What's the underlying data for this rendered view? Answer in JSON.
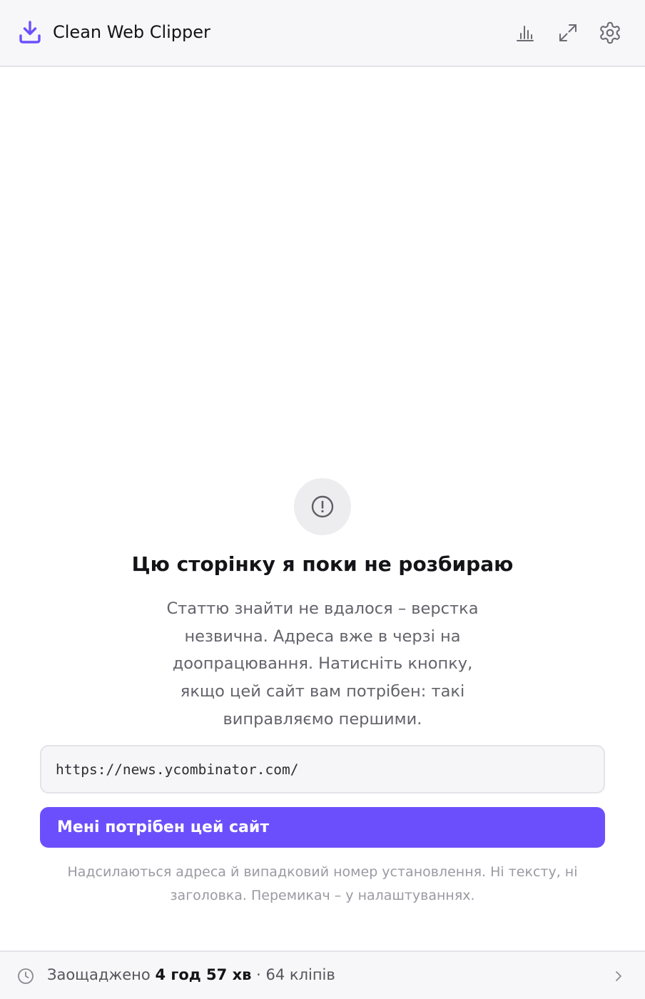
{
  "header": {
    "title": "Clean Web Clipper",
    "brand_icon": "download-tray-icon",
    "actions": [
      {
        "name": "stats-button",
        "icon": "bar-chart-icon"
      },
      {
        "name": "expand-button",
        "icon": "expand-arrows-icon"
      },
      {
        "name": "settings-button",
        "icon": "gear-icon"
      }
    ]
  },
  "empty_state": {
    "icon": "alert-circle-icon",
    "title": "Цю сторінку я поки не розбираю",
    "description_lines": [
      "Статтю знайти не вдалося – верстка",
      "незвична. Адреса вже в черзі на",
      "доопрацювання. Натисніть кнопку,",
      "якщо цей сайт вам потрібен: такі",
      "виправляємо першими."
    ],
    "url": "https://news.ycombinator.com/",
    "button_label": "Мені потрібен цей сайт",
    "note_lines": [
      "Надсилаються адреса й випадковий номер установлення. Ні тексту, ні",
      "заголовка. Перемикач – у налаштуваннях."
    ]
  },
  "footer": {
    "icon": "clock-icon",
    "saved_label": "Заощаджено",
    "saved_time": "4 год 57 хв",
    "separator": "·",
    "clips": "64 кліпів",
    "chevron": "chevron-right-icon"
  },
  "colors": {
    "accent": "#6c4ffc",
    "header_bg": "#f7f7f9",
    "border": "#e3e3e8",
    "muted_text": "#63636b",
    "note_text": "#9a9aa2"
  }
}
